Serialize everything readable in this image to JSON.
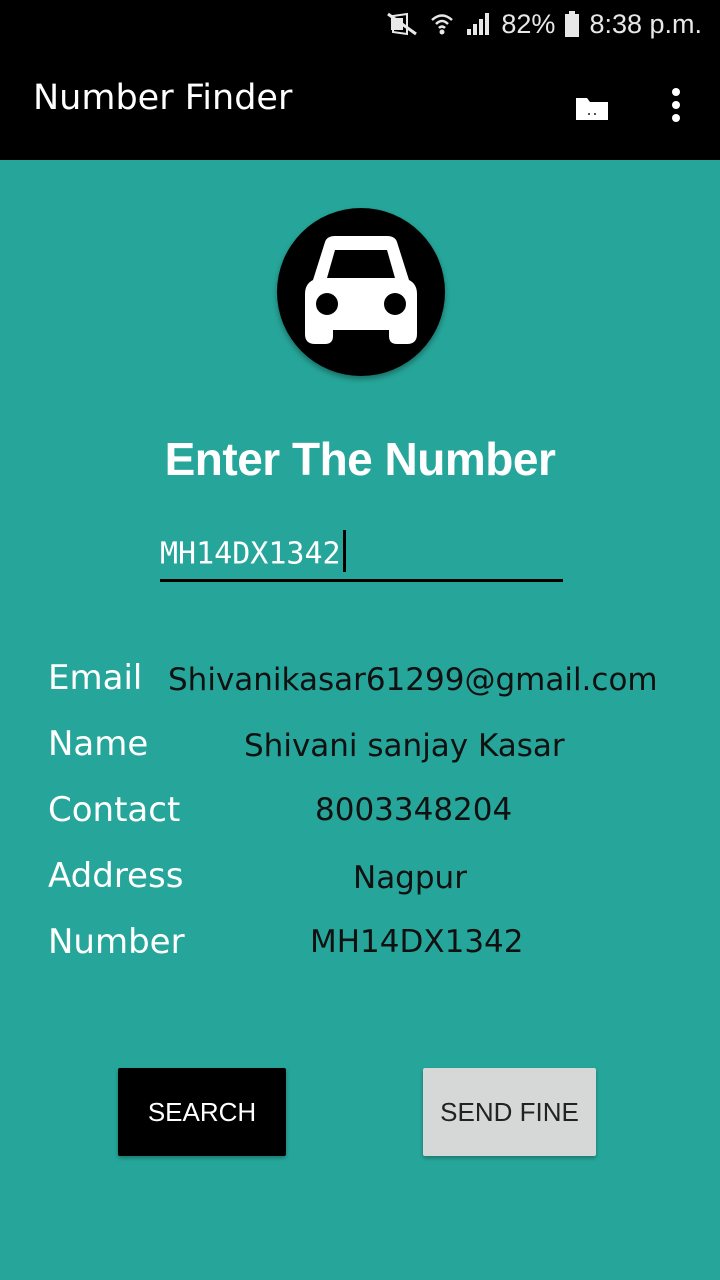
{
  "status_bar": {
    "battery_percent": "82%",
    "time": "8:38 p.m."
  },
  "app_bar": {
    "title": "Number Finder"
  },
  "heading": "Enter The Number",
  "number_input": {
    "value": "MH14DX1342"
  },
  "details": [
    {
      "label": "Email",
      "value": "Shivanikasar61299@gmail.com"
    },
    {
      "label": "Name",
      "value": "Shivani sanjay Kasar"
    },
    {
      "label": "Contact",
      "value": "8003348204"
    },
    {
      "label": "Address",
      "value": "Nagpur"
    },
    {
      "label": "Number",
      "value": "MH14DX1342"
    }
  ],
  "buttons": {
    "search": "SEARCH",
    "send_fine": "SEND FINE"
  },
  "colors": {
    "background": "#26a69a",
    "app_bar": "#000000",
    "search_button": "#000000",
    "send_fine_button": "#d6d7d7"
  },
  "icons": {
    "app_bar": [
      "folder-icon",
      "overflow-menu-icon"
    ],
    "logo": "car-icon",
    "status": [
      "mute-icon",
      "wifi-icon",
      "signal-icon",
      "battery-icon"
    ]
  }
}
